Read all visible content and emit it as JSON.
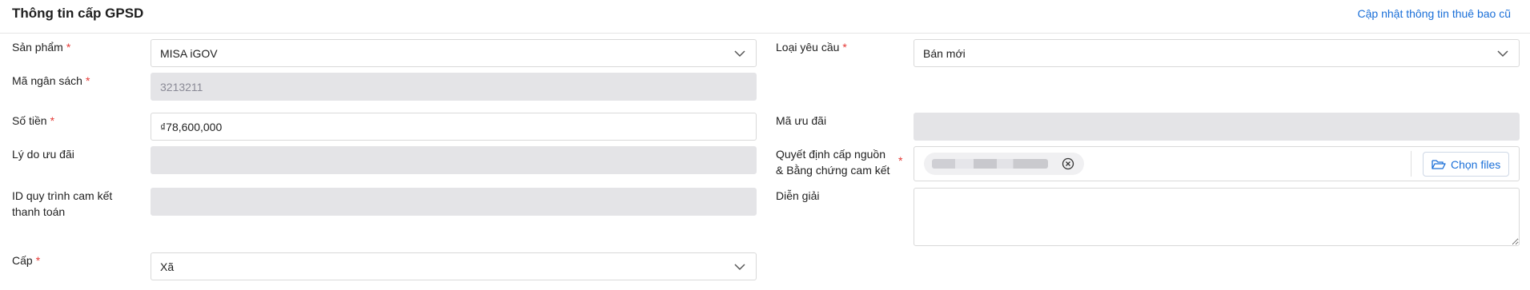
{
  "header": {
    "title": "Thông tin cấp GPSD",
    "update_link": "Cập nhật thông tin thuê bao cũ"
  },
  "left": {
    "product": {
      "label": "Sản phẩm",
      "required_mark": "*",
      "value": "MISA iGOV"
    },
    "budget_code": {
      "label": "Mã ngân sách",
      "required_mark": "*",
      "value": "3213211"
    },
    "amount": {
      "label": "Số tiền",
      "required_mark": "*",
      "value": "₫78,600,000"
    },
    "discount_reason": {
      "label": "Lý do ưu đãi",
      "value": ""
    },
    "payment_commit_id": {
      "label_line1": "ID quy trình cam kết",
      "label_line2": "thanh toán",
      "value": ""
    },
    "level": {
      "label": "Cấp",
      "required_mark": "*",
      "value": "Xã"
    }
  },
  "right": {
    "request_type": {
      "label": "Loại yêu cầu",
      "required_mark": "*",
      "value": "Bán mới"
    },
    "discount_code": {
      "label": "Mã ưu đãi",
      "value": ""
    },
    "funding_decision": {
      "label_line1": "Quyết định cấp nguồn",
      "label_line2": "& Bằng chứng cam kết",
      "required_mark": "*",
      "choose_files_label": "Chọn files",
      "attached_file_name": ""
    },
    "description": {
      "label": "Diễn giải",
      "value": ""
    }
  },
  "icons": {
    "dropdown": "chevron-down-icon",
    "remove_file": "close-circle-icon",
    "folder": "folder-open-icon"
  },
  "colors": {
    "accent": "#1a6fd8",
    "required": "#e53935",
    "disabled_bg": "#e4e4e7",
    "border": "#d9d9d9"
  }
}
